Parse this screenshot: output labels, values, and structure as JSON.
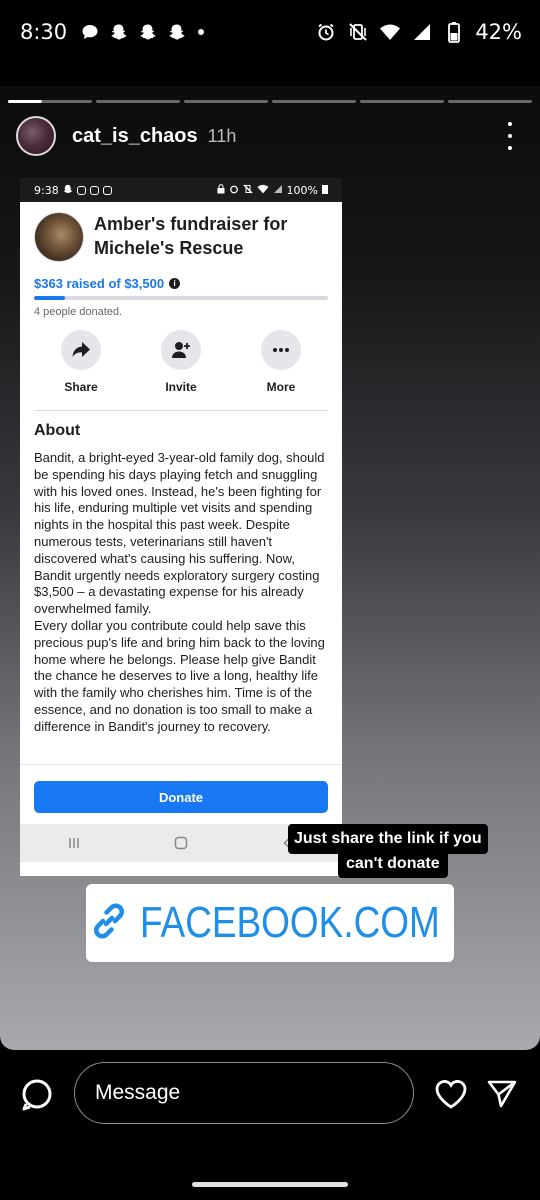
{
  "status_bar": {
    "time": "8:30",
    "battery": "42%"
  },
  "story": {
    "username": "cat_is_chaos",
    "time_ago": "11h",
    "segments": [
      {
        "state": "active"
      },
      {
        "state": "pending"
      },
      {
        "state": "pending"
      },
      {
        "state": "pending"
      },
      {
        "state": "pending"
      },
      {
        "state": "pending"
      }
    ]
  },
  "screenshot": {
    "status_time": "9:38",
    "status_battery": "100%",
    "fundraiser_title": "Amber's fundraiser for Michele's Rescue",
    "raised_text": "$363 raised of $3,500",
    "progress_fraction": 0.104,
    "donated_count_text": "4 people donated.",
    "actions": [
      {
        "label": "Share",
        "icon": "share-icon"
      },
      {
        "label": "Invite",
        "icon": "add-person-icon"
      },
      {
        "label": "More",
        "icon": "more-horizontal-icon"
      }
    ],
    "about_heading": "About",
    "about_p1": "Bandit, a bright-eyed 3-year-old family dog, should be spending his days playing fetch and snuggling with his loved ones. Instead, he's been fighting for his life, enduring multiple vet visits and spending nights in the hospital this past week. Despite numerous tests, veterinarians still haven't discovered what's causing his suffering. Now, Bandit urgently needs exploratory surgery costing $3,500 – a devastating expense for his already overwhelmed family.",
    "about_p2": "Every dollar you contribute could help save this precious pup's life and bring him back to the loving home where he belongs. Please help give Bandit the chance he deserves to live a long, healthy life with the family who cherishes him. Time is of the essence, and no donation is too small to make a difference in Bandit's journey to recovery.",
    "donate_label": "Donate"
  },
  "stickers": {
    "caption_line1": "Just share the link if you",
    "caption_line2": "can't donate",
    "link_text": "FACEBOOK.COM",
    "link_color": "#1e8ee6"
  },
  "reply_bar": {
    "placeholder": "Message"
  },
  "colors": {
    "facebook_blue": "#1877f2"
  }
}
